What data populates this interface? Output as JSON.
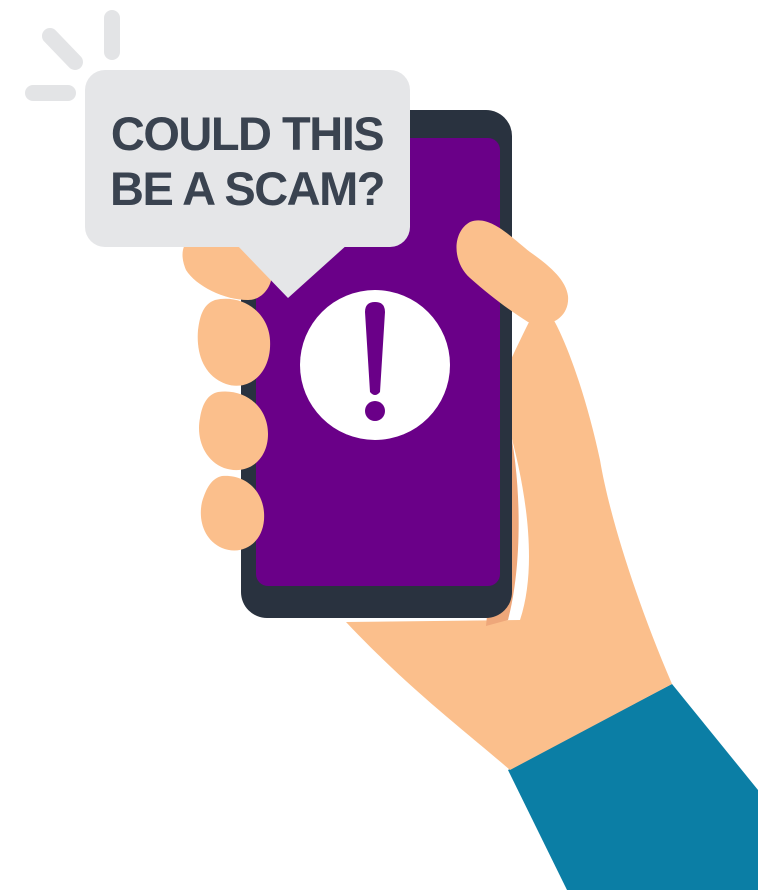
{
  "bubble": {
    "line1": "COULD THIS",
    "line2": "BE A SCAM?"
  },
  "alert": {
    "symbol": "!",
    "icon": "exclamation-icon"
  },
  "colors": {
    "screen": "#6a0088",
    "phone_frame": "#29323f",
    "skin": "#fbbf8c",
    "skin_shadow": "#eea77a",
    "sleeve": "#0b7ea5",
    "bubble": "#e5e6e8",
    "bubble_text": "#3a4350",
    "burst_lines": "#e3e4e6"
  }
}
